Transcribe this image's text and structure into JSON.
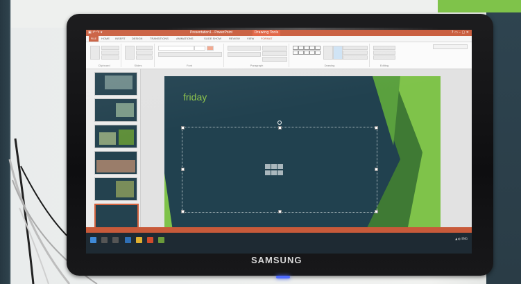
{
  "photo": {
    "subject": "monitor-on-desk",
    "colors": {
      "slide_bg": "#21414f",
      "accent_green": "#8cc34a",
      "office_orange": "#c85a3a"
    }
  },
  "monitor": {
    "brand": "SAMSUNG"
  },
  "app": {
    "window_title": "Presentation1 - PowerPoint",
    "tool_tab_title": "Drawing Tools",
    "tabs": [
      "FILE",
      "HOME",
      "INSERT",
      "DESIGN",
      "TRANSITIONS",
      "ANIMATIONS",
      "SLIDE SHOW",
      "REVIEW",
      "VIEW",
      "FORMAT"
    ],
    "ribbon_groups": [
      "Clipboard",
      "Slides",
      "Font",
      "Paragraph",
      "Drawing",
      "Editing"
    ]
  },
  "slide": {
    "title": "friday"
  }
}
